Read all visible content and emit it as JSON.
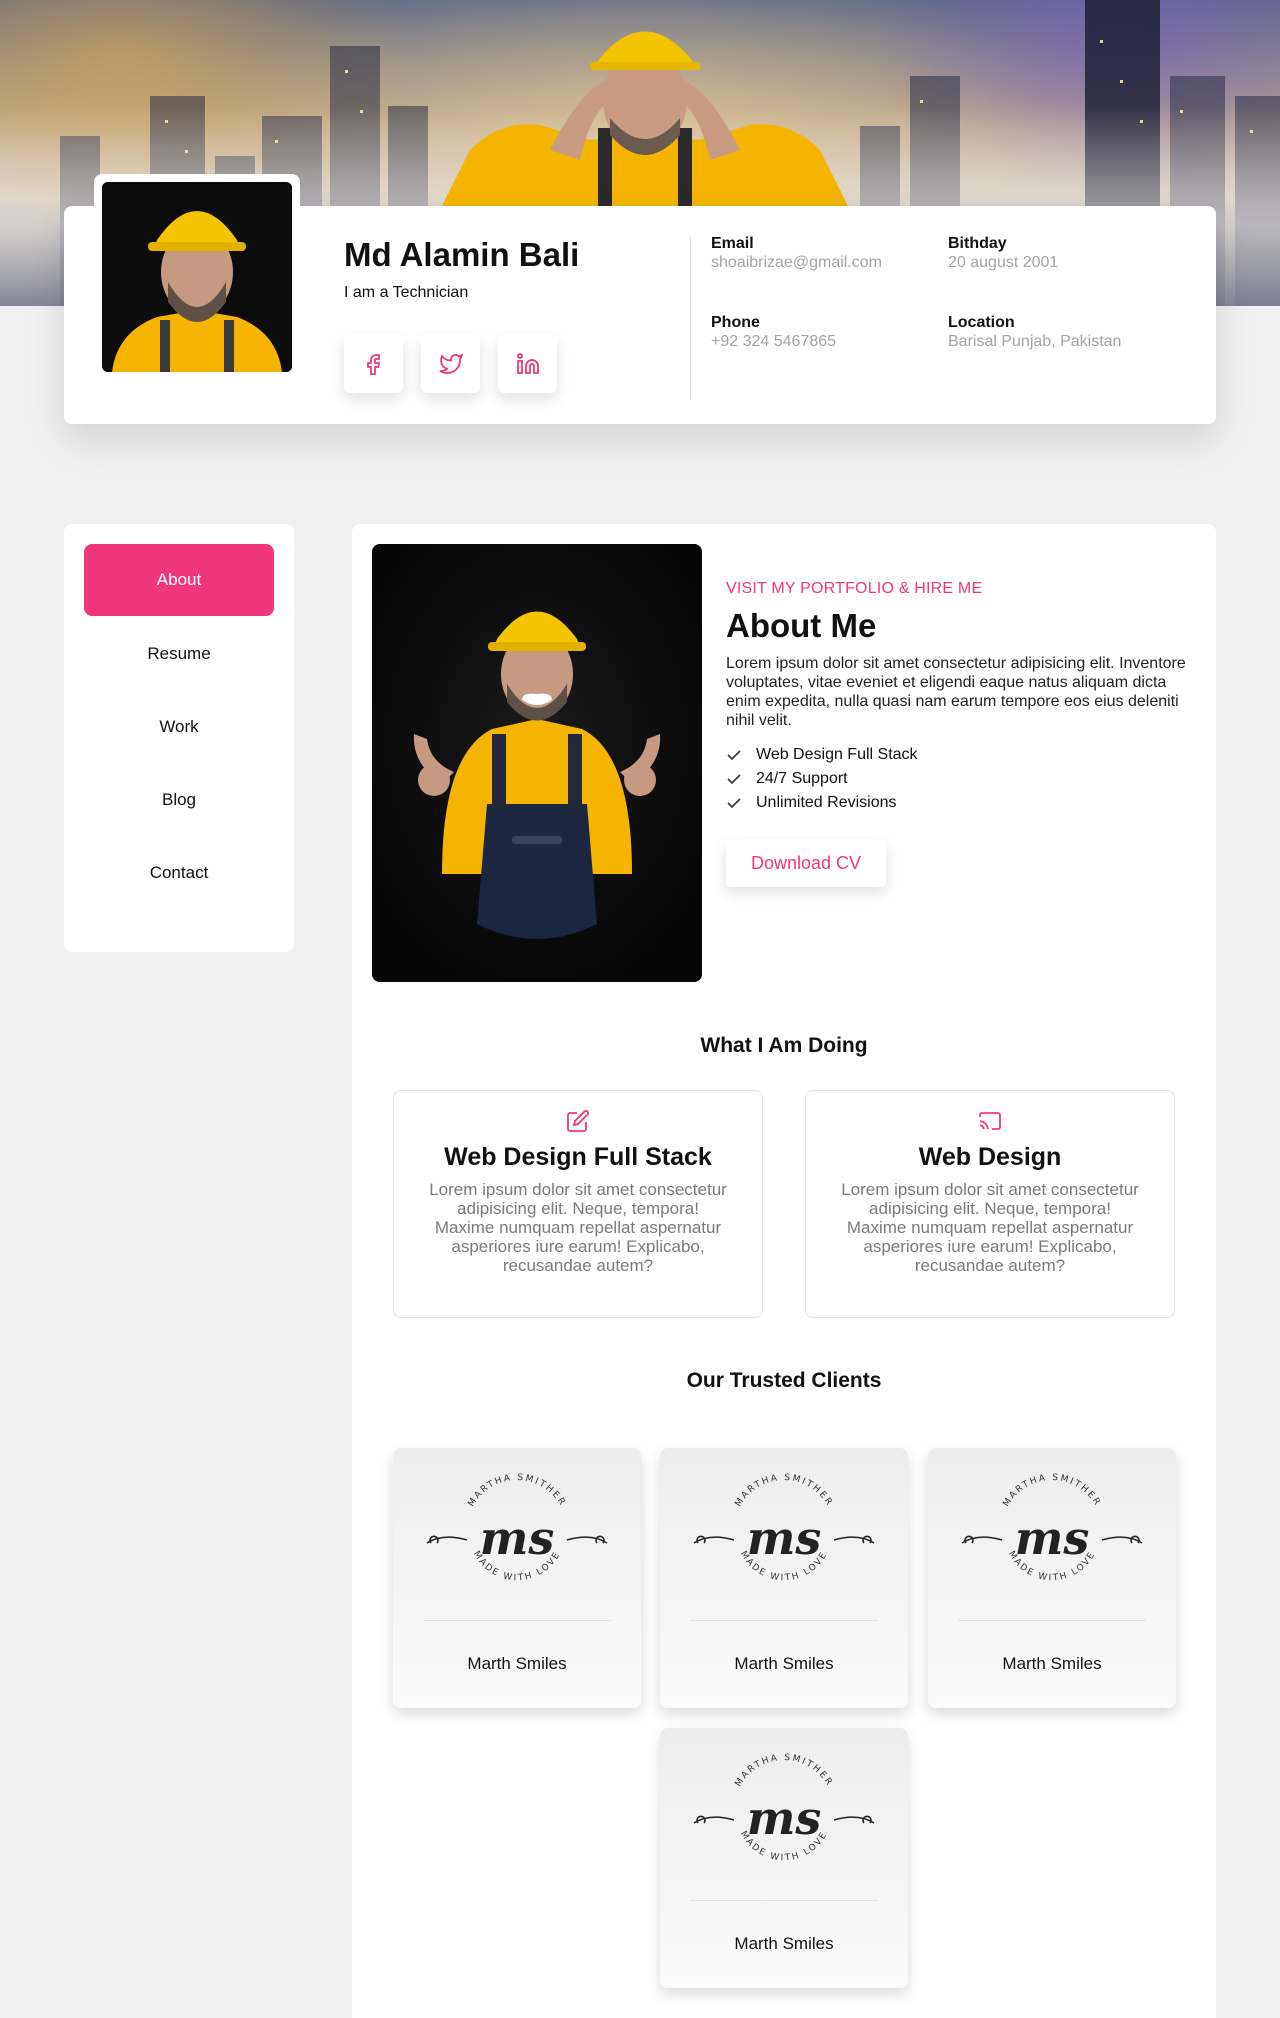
{
  "profile": {
    "name": "Md Alamin Bali",
    "role": "I am a Technician",
    "socials": [
      "facebook-icon",
      "twitter-icon",
      "linkedin-icon"
    ],
    "info": {
      "email_label": "Email",
      "email_value": "shoaibrizae@gmail.com",
      "birthday_label": "Bithday",
      "birthday_value": "20 august 2001",
      "phone_label": "Phone",
      "phone_value": "+92 324 5467865",
      "location_label": "Location",
      "location_value": "Barisal Punjab, Pakistan"
    }
  },
  "nav": {
    "items": [
      {
        "label": "About",
        "active": true
      },
      {
        "label": "Resume",
        "active": false
      },
      {
        "label": "Work",
        "active": false
      },
      {
        "label": "Blog",
        "active": false
      },
      {
        "label": "Contact",
        "active": false
      }
    ]
  },
  "about": {
    "eyebrow": "VISIT MY PORTFOLIO & HIRE ME",
    "title": "About Me",
    "description": "Lorem ipsum dolor sit amet consectetur adipisicing elit. Inventore voluptates, vitae eveniet et eligendi eaque natus aliquam dicta enim expedita, nulla quasi nam earum tempore eos eius deleniti nihil velit.",
    "checklist": [
      "Web Design Full Stack",
      "24/7 Support",
      "Unlimited Revisions"
    ],
    "download_label": "Download CV"
  },
  "services": {
    "heading": "What I Am Doing",
    "items": [
      {
        "icon": "edit-icon",
        "title": "Web Design Full Stack",
        "desc": "Lorem ipsum dolor sit amet consectetur adipisicing elit. Neque, tempora! Maxime numquam repellat aspernatur asperiores iure earum! Explicabo, recusandae autem?"
      },
      {
        "icon": "cast-icon",
        "title": "Web Design",
        "desc": "Lorem ipsum dolor sit amet consectetur adipisicing elit. Neque, tempora! Maxime numquam repellat aspernatur asperiores iure earum! Explicabo, recusandae autem?"
      }
    ]
  },
  "clients": {
    "heading": "Our Trusted Clients",
    "items": [
      {
        "name": "Marth Smiles",
        "logo_top": "MARTHA SMITHER",
        "logo_mark": "ms",
        "logo_bottom": "MADE WITH LOVE"
      },
      {
        "name": "Marth Smiles",
        "logo_top": "MARTHA SMITHER",
        "logo_mark": "ms",
        "logo_bottom": "MADE WITH LOVE"
      },
      {
        "name": "Marth Smiles",
        "logo_top": "MARTHA SMITHER",
        "logo_mark": "ms",
        "logo_bottom": "MADE WITH LOVE"
      },
      {
        "name": "Marth Smiles",
        "logo_top": "MARTHA SMITHER",
        "logo_mark": "ms",
        "logo_bottom": "MADE WITH LOVE"
      }
    ]
  },
  "colors": {
    "accent": "#f0377c",
    "page_bg": "#f0f0f0",
    "hard_hat": "#f5c400",
    "shirt": "#f7b500"
  }
}
